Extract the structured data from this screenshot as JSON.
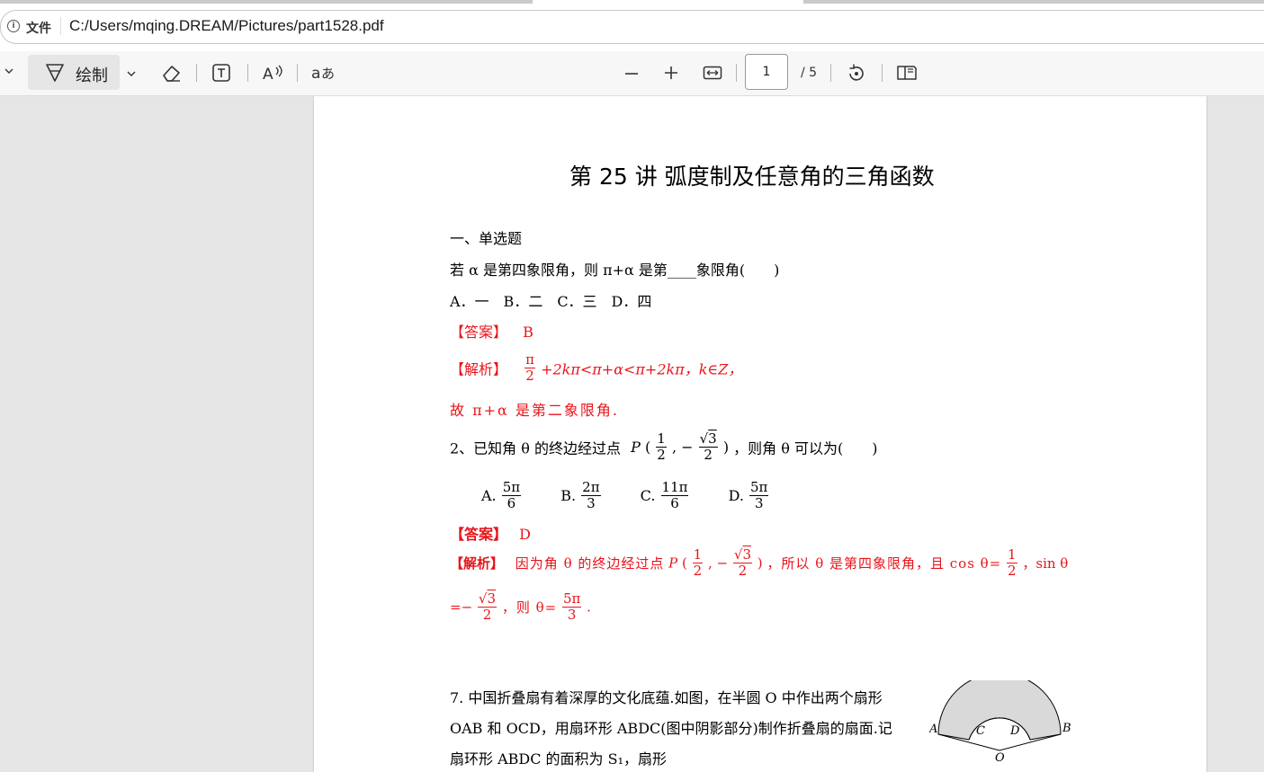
{
  "address_bar": {
    "file_label": "文件",
    "url": "C:/Users/mqing.DREAM/Pictures/part1528.pdf"
  },
  "toolbar": {
    "draw_label": "绘制",
    "page_current": "1",
    "page_total": "/ 5"
  },
  "document": {
    "title": "第 25 讲  弧度制及任意角的三角函数",
    "section": "一、单选题",
    "q1": {
      "stem": "若 α 是第四象限角，则 π+α 是第____象限角(　　)",
      "options": "A．一　B．二　C．三　D．四",
      "answer_label": "【答案】",
      "answer": "B",
      "analysis_label": "【解析】",
      "analysis_num": "π",
      "analysis_den": "2",
      "analysis_rest": "+2kπ<π+α<π+2kπ，k∈Z，",
      "conclusion": "故 π+α 是第二象限角."
    },
    "q2": {
      "prefix": "2、已知角 θ 的终边经过点",
      "point_label": "P",
      "suffix": "，则角 θ 可以为(　　)",
      "frac_half_num": "1",
      "frac_half_den": "2",
      "sqrt3": "3",
      "den2": "2",
      "opt_a": "A.",
      "opt_a_num": "5π",
      "opt_a_den": "6",
      "opt_b": "B.",
      "opt_b_num": "2π",
      "opt_b_den": "3",
      "opt_c": "C.",
      "opt_c_num": "11π",
      "opt_c_den": "6",
      "opt_d": "D.",
      "opt_d_num": "5π",
      "opt_d_den": "3",
      "answer_label": "【答案】",
      "answer": "D",
      "analysis_label": "【解析】",
      "analysis_text1": "因为角 θ 的终边经过点",
      "analysis_text2": "，所以 θ 是第四象限角，且 cos θ=",
      "analysis_text3": "，sin θ",
      "analysis_line2_a": "=−",
      "analysis_line2_b": "，则 θ=",
      "analysis_line2_num": "5π",
      "analysis_line2_den": "3",
      "analysis_line2_end": "."
    },
    "q7": {
      "line1": "7. 中国折叠扇有着深厚的文化底蕴.如图，在半圆 O 中作出两个扇形",
      "line2": "OAB 和 OCD，用扇环形 ABDC(图中阴影部分)制作折叠扇的扇面.记",
      "line3": "扇环形 ABDC 的面积为 S₁，扇形",
      "fig_labels": {
        "A": "A",
        "B": "B",
        "C": "C",
        "D": "D",
        "O": "O"
      }
    }
  },
  "colors": {
    "accent_red": "#e8141b",
    "shade": "#d9d9d9"
  }
}
